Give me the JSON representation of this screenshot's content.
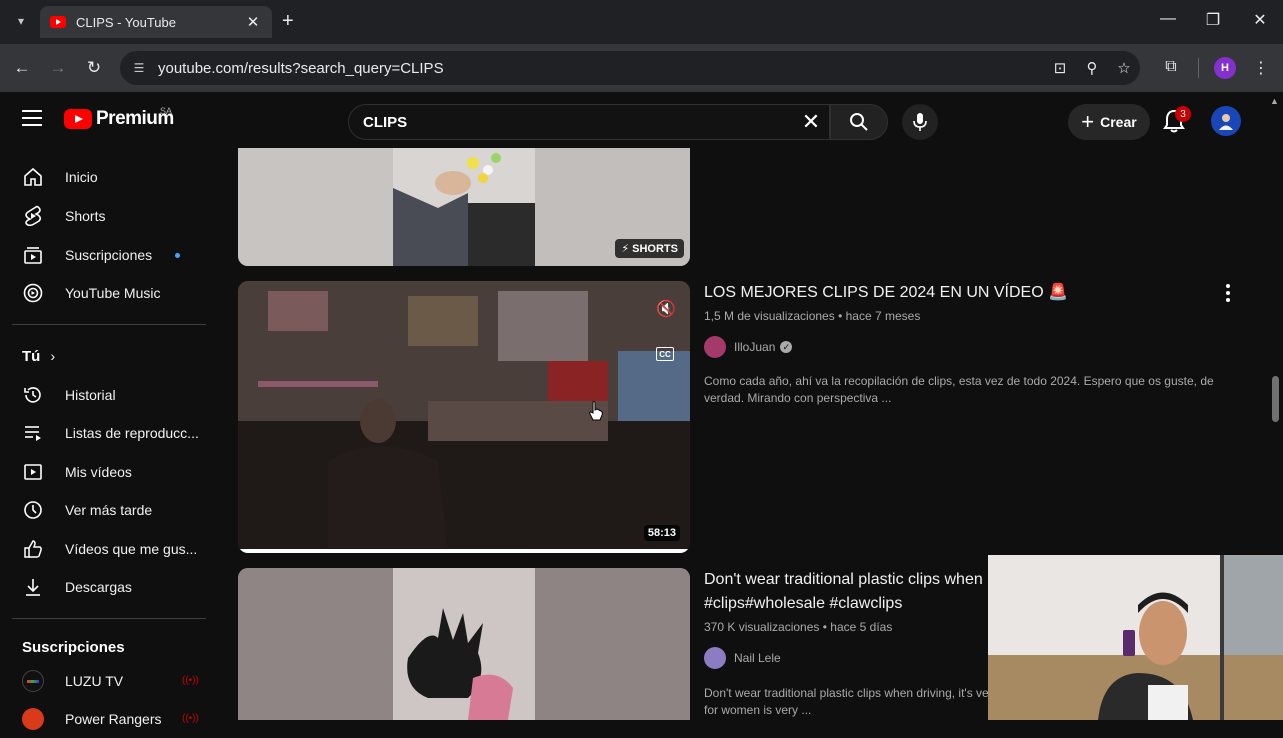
{
  "browser": {
    "tab_title": "CLIPS - YouTube",
    "url": "youtube.com/results?search_query=CLIPS",
    "profile_initial": "H"
  },
  "header": {
    "logo_text": "Premium",
    "country_code": "SA",
    "search_value": "CLIPS",
    "create_label": "Crear",
    "notification_count": "3"
  },
  "sidebar": {
    "items": [
      {
        "label": "Inicio",
        "icon": "home-icon"
      },
      {
        "label": "Shorts",
        "icon": "shorts-icon"
      },
      {
        "label": "Suscripciones",
        "icon": "subscriptions-icon"
      },
      {
        "label": "YouTube Music",
        "icon": "youtube-music-icon"
      }
    ],
    "you_heading": "Tú",
    "you_items": [
      {
        "label": "Historial",
        "icon": "history-icon"
      },
      {
        "label": "Listas de reproducc...",
        "icon": "playlists-icon"
      },
      {
        "label": "Mis vídeos",
        "icon": "my-videos-icon"
      },
      {
        "label": "Ver más tarde",
        "icon": "watch-later-icon"
      },
      {
        "label": "Vídeos que me gus...",
        "icon": "liked-videos-icon"
      },
      {
        "label": "Descargas",
        "icon": "downloads-icon"
      }
    ],
    "subscriptions_heading": "Suscripciones",
    "subscriptions": [
      {
        "label": "LUZU TV"
      },
      {
        "label": "Power Rangers"
      }
    ]
  },
  "results": [
    {
      "badge": "SHORTS"
    },
    {
      "title": "LOS MEJORES CLIPS DE 2024 EN UN VÍDEO 🚨",
      "views": "1,5 M de visualizaciones",
      "age": "hace 7 meses",
      "channel": "IlloJuan",
      "description": "Como cada año, ahí va la recopilación de clips, esta vez de todo 2024. Espero que os guste, de verdad. Mirando con perspectiva ...",
      "duration": "58:13",
      "progress": 1.0
    },
    {
      "title_line1": "Don't wear traditional plastic clips when",
      "title_line2": "#clips#wholesale #clawclips",
      "views": "370 K visualizaciones",
      "age": "hace 5 días",
      "channel": "Nail Lele",
      "description_line1": "Don't wear traditional plastic clips when driving, it's very dar",
      "description_line2": "for women is very ..."
    }
  ],
  "colors": {
    "background": "#0f0f0f",
    "accent_red": "#ff0000",
    "badge_red": "#cc0000",
    "subscription_dot": "#3ea6ff"
  }
}
